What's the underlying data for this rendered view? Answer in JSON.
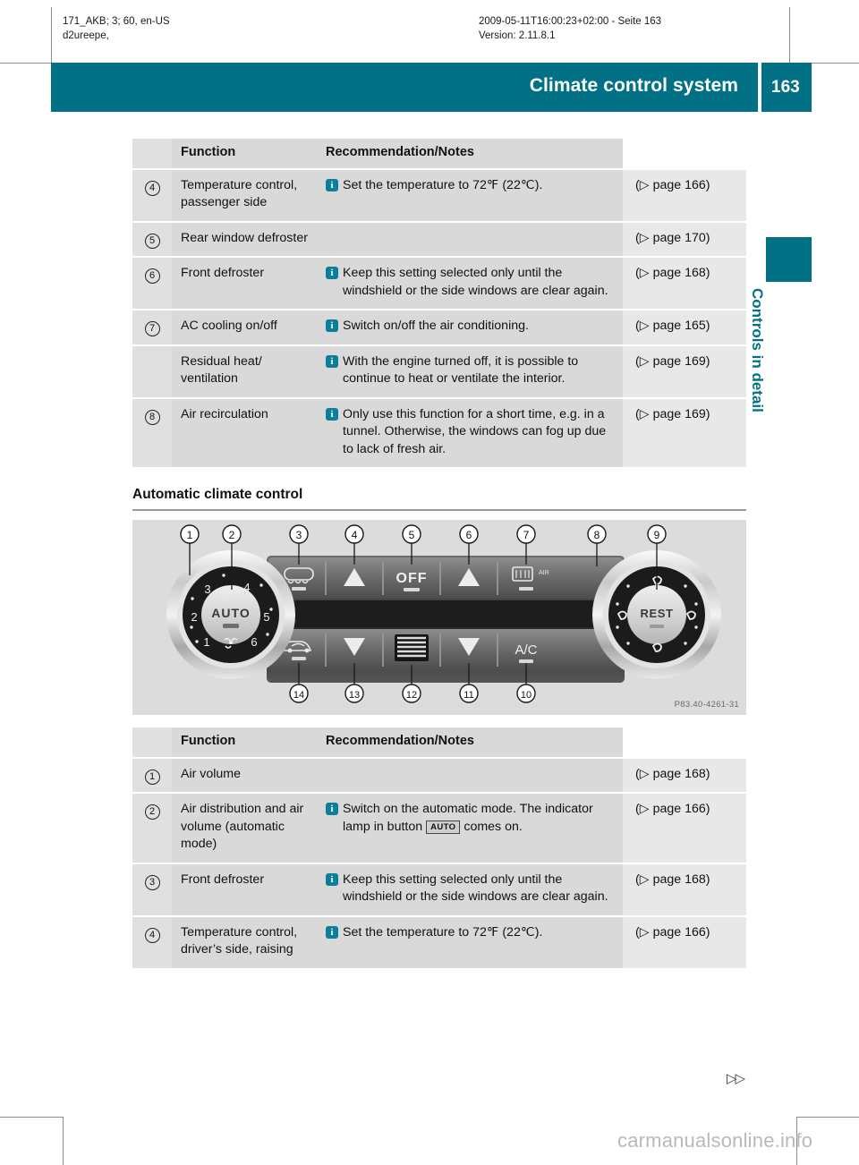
{
  "running_header": {
    "left_line1": "171_AKB; 3; 60, en-US",
    "left_line2": "d2ureepe,",
    "right_line1": "2009-05-11T16:00:23+02:00 - Seite 163",
    "right_line2": "Version: 2.11.8.1"
  },
  "banner": {
    "title": "Climate control system",
    "page_number": "163",
    "color": "#027185"
  },
  "sidebar": {
    "chapter_title": "Controls in detail",
    "tab_color": "#027185"
  },
  "table_top": {
    "headers": {
      "num": "",
      "function": "Function",
      "recommendation": "Recommendation/Notes",
      "reference": ""
    },
    "rows": [
      {
        "num": "4",
        "function": "Temperature control, passenger side",
        "note": "Set the temperature to 72℉ (22℃).",
        "has_note": true,
        "ref": "(▷ page 166)"
      },
      {
        "num": "5",
        "function": "Rear window defroster",
        "note": "",
        "has_note": false,
        "ref": "(▷ page 170)"
      },
      {
        "num": "6",
        "function": "Front defroster",
        "note": "Keep this setting selected only until the windshield or the side windows are clear again.",
        "has_note": true,
        "ref": "(▷ page 168)"
      },
      {
        "num": "7",
        "function": "AC cooling on/off",
        "note": "Switch on/off the air conditioning.",
        "has_note": true,
        "ref": "(▷ page 165)"
      },
      {
        "num": "",
        "function": "Residual heat/ ventilation",
        "note": "With the engine turned off, it is possible to continue to heat or ventilate the interior.",
        "has_note": true,
        "ref": "(▷ page 169)"
      },
      {
        "num": "8",
        "function": "Air recirculation",
        "note": "Only use this function for a short time, e.g. in a tunnel. Otherwise, the windows can fog up due to lack of fresh air.",
        "has_note": true,
        "ref": "(▷ page 169)"
      }
    ]
  },
  "section": {
    "heading": "Automatic climate control"
  },
  "figure": {
    "caption": "P83.40-4261-31",
    "callouts_top": [
      "1",
      "2",
      "3",
      "4",
      "5",
      "6",
      "7",
      "8",
      "9"
    ],
    "callouts_bottom": [
      "14",
      "13",
      "12",
      "11",
      "10"
    ],
    "left_dial_label": "AUTO",
    "left_dial_digits": [
      "1",
      "2",
      "3",
      "4",
      "5",
      "6"
    ],
    "right_dial_label": "REST",
    "button_labels": [
      "OFF",
      "A/C"
    ]
  },
  "table_bottom": {
    "headers": {
      "num": "",
      "function": "Function",
      "recommendation": "Recommendation/Notes",
      "reference": ""
    },
    "rows": [
      {
        "num": "1",
        "function": "Air volume",
        "note": "",
        "has_note": false,
        "ref": "(▷ page 168)"
      },
      {
        "num": "2",
        "function": "Air distribution and air volume (automatic mode)",
        "note_pre": "Switch on the automatic mode. The indicator lamp in button ",
        "note_keycap": "AUTO",
        "note_post": " comes on.",
        "has_note": true,
        "has_keycap": true,
        "ref": "(▷ page 166)"
      },
      {
        "num": "3",
        "function": "Front defroster",
        "note": "Keep this setting selected only until the windshield or the side windows are clear again.",
        "has_note": true,
        "ref": "(▷ page 168)"
      },
      {
        "num": "4",
        "function": "Temperature control, driver’s side, raising",
        "note": "Set the temperature to 72℉ (22℃).",
        "has_note": true,
        "ref": "(▷ page 166)"
      }
    ]
  },
  "footer": {
    "continuation_marker": "▷▷",
    "watermark": "carmanualsonline.info"
  }
}
